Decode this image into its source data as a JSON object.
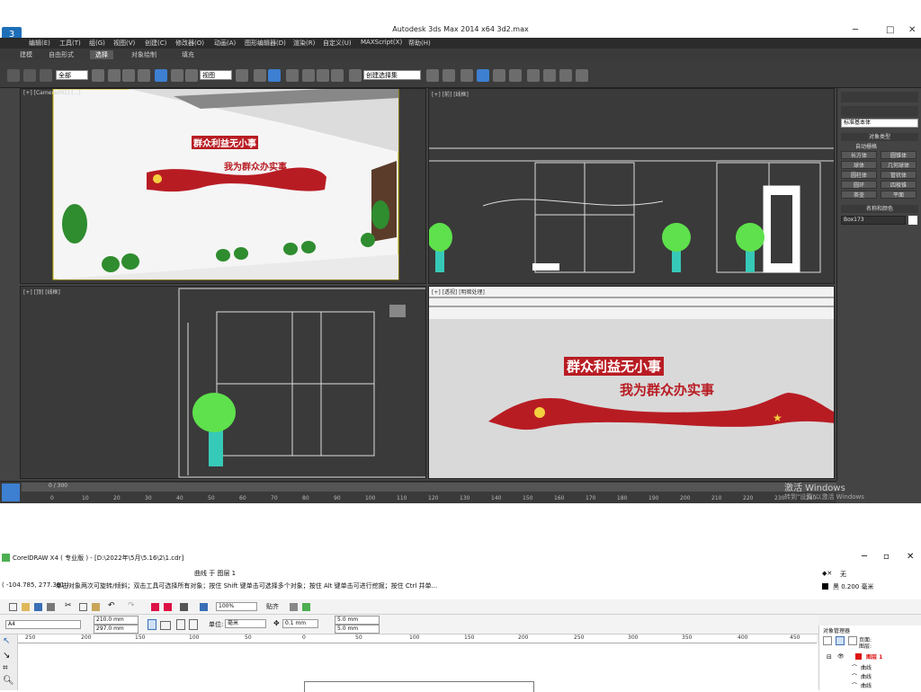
{
  "max": {
    "title": "Autodesk 3ds Max  2014 x64        3d2.max",
    "menu": [
      "编辑(E)",
      "工具(T)",
      "组(G)",
      "视图(V)",
      "创建(C)",
      "修改器(O)",
      "动画(A)",
      "图形编辑器(D)",
      "渲染(R)",
      "自定义(U)",
      "MAXScript(X)",
      "帮助(H)"
    ],
    "ribbon": [
      "建模",
      "自由形式",
      "选择",
      "对象绘制",
      "填充"
    ],
    "ribbon_selected": "选择",
    "toolbar": {
      "filter": "全部",
      "view": "视图",
      "named_selection": "创建选择集"
    },
    "viewports": {
      "camera": "[+] [Camera001] [...]",
      "front": "[+] [前] [线框]",
      "top": "[+] [顶] [线框]",
      "render": "[+] [透视] [明暗处理]"
    },
    "slogan_line1": "群众利益无小事",
    "slogan_line2": "我为群众办实事",
    "cmd_panel": {
      "dropdown": "标准基本体",
      "object_type_header": "对象类型",
      "autogrid": "自动栅格",
      "buttons": [
        "长方体",
        "圆锥体",
        "球体",
        "几何球体",
        "圆柱体",
        "管状体",
        "圆环",
        "四棱锥",
        "茶壶",
        "平面"
      ],
      "name_color_header": "名称和颜色",
      "object_name": "Box173"
    },
    "timeline": {
      "frame": "0 / 300",
      "ticks": [
        "0",
        "10",
        "20",
        "30",
        "40",
        "50",
        "60",
        "70",
        "80",
        "90",
        "100",
        "110",
        "120",
        "130",
        "140",
        "150",
        "160",
        "170",
        "180",
        "190",
        "200",
        "210",
        "220",
        "230",
        "240"
      ]
    },
    "activate_windows": "激活 Windows",
    "activate_sub": "转到\"设置\"以激活 Windows"
  },
  "cdr": {
    "title": "CorelDRAW X4 ( 专业版 ) - [D:\\2022年\\5月\\5.16\\2\\1.cdr]",
    "object_info": "曲线 于 图层 1",
    "coords": "( -104.785, 277.361 )",
    "hint": "单击对象两次可旋转/倾斜；双击工具可选择所有对象；按住 Shift 键单击可选择多个对象；按住 Alt 键单击可进行挖掘；按住 Ctrl 并单...",
    "fill": "无",
    "outline": "黑  0.200 毫米",
    "zoom": "100%",
    "snap": "贴齐",
    "page_size": "A4",
    "width": "210.0 mm",
    "height": "297.0 mm",
    "units_label": "单位:",
    "units": "毫米",
    "nudge": "0.1 mm",
    "dup_x": "5.0 mm",
    "dup_y": "5.0 mm",
    "ruler": [
      "250",
      "200",
      "150",
      "100",
      "50",
      "0",
      "50",
      "100",
      "150",
      "200",
      "250",
      "300",
      "350",
      "400",
      "450"
    ],
    "docker": {
      "title": "对象管理器",
      "page": "页面:",
      "layer_top": "图层:",
      "layer": "图层 1",
      "items": [
        "曲线",
        "曲线",
        "曲线"
      ]
    }
  }
}
